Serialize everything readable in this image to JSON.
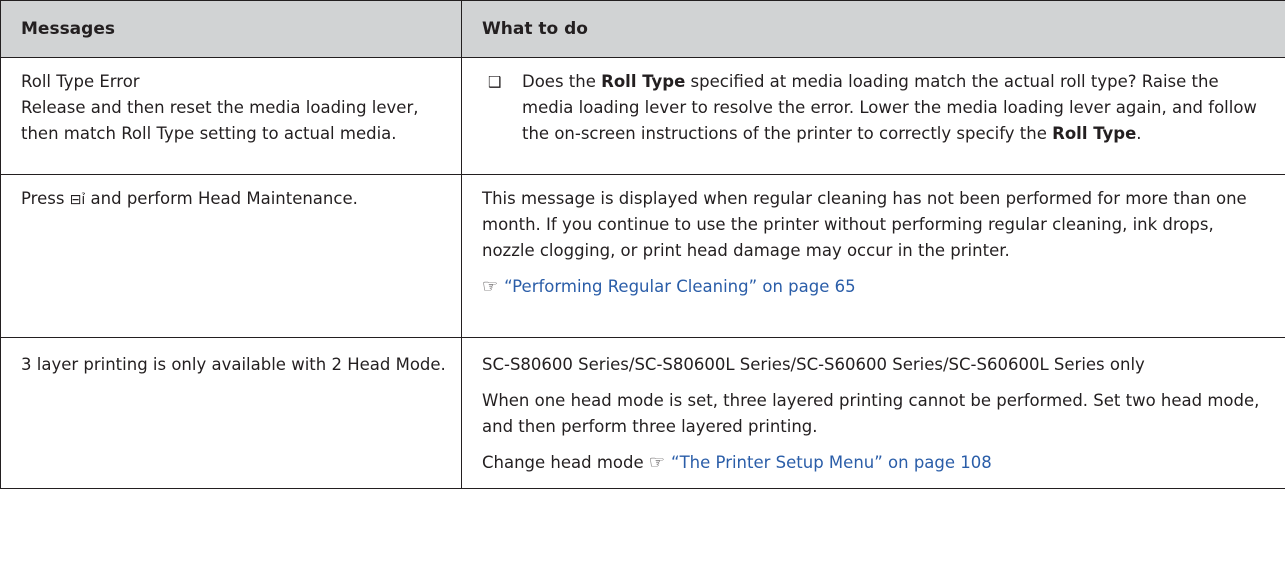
{
  "header": {
    "col1": "Messages",
    "col2": "What to do"
  },
  "rows": [
    {
      "message": [
        "Roll Type Error",
        "Release and then reset the media loading lever, then match Roll Type setting to actual media."
      ],
      "bullet_symbol": "❑",
      "action": {
        "p1": "Does the ",
        "b1": "Roll Type",
        "p2": " specified at media loading match the actual roll type? Raise the media loading lever to resolve the error. Lower the media loading lever again, and follow the on-screen instructions of the printer to correctly specify the ",
        "b2": "Roll Type",
        "p3": "."
      }
    },
    {
      "message_pre": "Press ",
      "message_icon": "⊟ỉ",
      "message_post": " and perform Head Maintenance.",
      "action": {
        "text": "This message is displayed when regular cleaning has not been performed for more than one month. If you continue to use the printer without performing regular cleaning, ink drops, nozzle clogging, or print head damage may occur in the printer.",
        "ref_symbol": "☞",
        "link": "“Performing Regular Cleaning” on page 65"
      }
    },
    {
      "message": "3 layer printing is only available with 2 Head Mode.",
      "action": {
        "p1": "SC-S80600 Series/SC-S80600L Series/SC-S60600 Series/SC-S60600L Series only",
        "p2": "When one head mode is set, three layered printing cannot be performed. Set two head mode, and then perform three layered printing.",
        "p3_pre": "Change head mode ",
        "ref_symbol": "☞",
        "link": "“The Printer Setup Menu” on page 108"
      }
    }
  ]
}
